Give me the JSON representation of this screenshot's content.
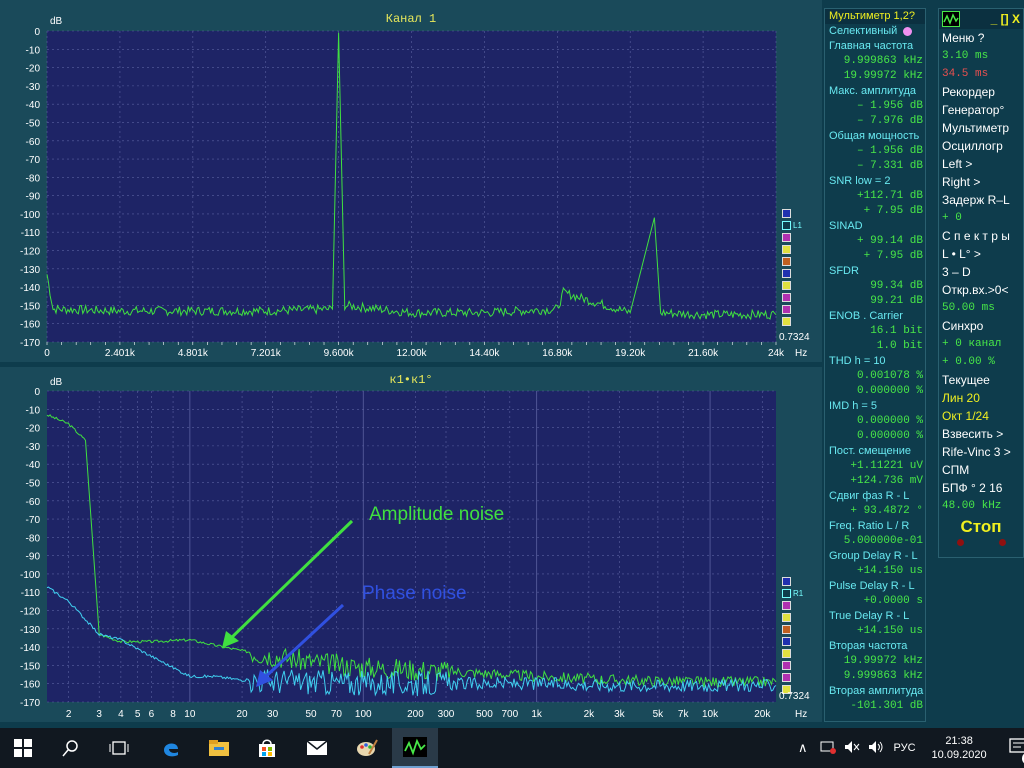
{
  "top_chart": {
    "title": "Канал 1",
    "y_unit": "dB",
    "x_unit": "Hz",
    "zoom_value": "0.7324",
    "legend_label": "L1",
    "y_ticks": [
      "0",
      "-10",
      "-20",
      "-30",
      "-40",
      "-50",
      "-60",
      "-70",
      "-80",
      "-90",
      "-100",
      "-110",
      "-120",
      "-130",
      "-140",
      "-150",
      "-160",
      "-170"
    ],
    "x_ticks": [
      "0",
      "2.401k",
      "4.801k",
      "7.201k",
      "9.600k",
      "12.00k",
      "14.40k",
      "16.80k",
      "19.20k",
      "21.60k",
      "24k"
    ],
    "legend_colors": [
      "#2030b0",
      "#2aa0b0",
      "#b030b0",
      "#e0e040",
      "#c06020",
      "#2030b0",
      "#e0e040",
      "#b030b0",
      "#b030b0",
      "#e0e040"
    ]
  },
  "bottom_chart": {
    "title": "к1•к1°",
    "y_unit": "dB",
    "x_unit": "Hz",
    "zoom_value": "0.7324",
    "legend_label": "R1",
    "y_ticks": [
      "0",
      "-10",
      "-20",
      "-30",
      "-40",
      "-50",
      "-60",
      "-70",
      "-80",
      "-90",
      "-100",
      "-110",
      "-120",
      "-130",
      "-140",
      "-150",
      "-160",
      "-170"
    ],
    "x_ticks": [
      "2",
      "3",
      "4",
      "5",
      "6",
      "8",
      "10",
      "20",
      "30",
      "50",
      "70",
      "100",
      "200",
      "300",
      "500",
      "700",
      "1k",
      "2k",
      "3k",
      "5k",
      "7k",
      "10k",
      "20k"
    ],
    "legend_colors": [
      "#2030b0",
      "#2aa0b0",
      "#b030b0",
      "#e0e040",
      "#c06020",
      "#2030b0",
      "#e0e040",
      "#b030b0",
      "#b030b0",
      "#e0e040"
    ],
    "annotation_amplitude": "Amplitude  noise",
    "annotation_phase": "Phase noise",
    "color_amplitude": "#40e040",
    "color_phase": "#3050e0"
  },
  "chart_data": [
    {
      "type": "line",
      "title": "Канал 1",
      "ylabel": "dB",
      "xlabel": "Hz",
      "xlim": [
        0,
        24000
      ],
      "ylim": [
        -170,
        0
      ],
      "grid": true,
      "series": [
        {
          "color": "#40e040",
          "x": [
            0,
            200,
            2400,
            4800,
            7200,
            9400,
            9600,
            9800,
            12000,
            14400,
            16800,
            17000,
            19200,
            19998,
            20200,
            21600,
            24000
          ],
          "y": [
            -133,
            -152,
            -153,
            -153,
            -153,
            -152,
            -1,
            -150,
            -154,
            -154,
            -152,
            -143,
            -154,
            -102,
            -154,
            -155,
            -155
          ]
        }
      ]
    },
    {
      "type": "line",
      "title": "к1•к1°",
      "ylabel": "dB",
      "xlabel": "Hz",
      "xscale": "log",
      "xlim": [
        1.5,
        24000
      ],
      "ylim": [
        -170,
        0
      ],
      "grid": true,
      "series": [
        {
          "name": "Amplitude  noise",
          "color": "#40e040",
          "x": [
            1.5,
            2,
            2.5,
            3,
            4,
            6,
            10,
            14,
            20,
            50,
            100,
            300,
            1000,
            3000,
            10000,
            20000,
            24000
          ],
          "y": [
            -13,
            -18,
            -27,
            -133,
            -137,
            -137,
            -136,
            -139,
            -142,
            -148,
            -151,
            -153,
            -156,
            -158,
            -159,
            -159,
            -159
          ]
        },
        {
          "name": "Phase noise",
          "color": "#40d0f0",
          "x": [
            1.5,
            2,
            3,
            4,
            6,
            10,
            14,
            20,
            50,
            100,
            300,
            1000,
            3000,
            10000,
            20000,
            24000
          ],
          "y": [
            -107,
            -115,
            -133,
            -136,
            -145,
            -156,
            -156,
            -158,
            -159,
            -160,
            -160,
            -160,
            -161,
            -161,
            -161,
            -161
          ]
        }
      ]
    }
  ],
  "multimeter": {
    "rows": [
      {
        "t": "Мультиметр 1,2?",
        "c": "head"
      },
      {
        "t": "Селективный",
        "c": "lbl"
      },
      {
        "t": "Главная частота",
        "c": "lbl"
      },
      {
        "t": "9.999863 kHz",
        "c": "val"
      },
      {
        "t": "19.99972 kHz",
        "c": "val"
      },
      {
        "t": "Макс. амплитуда",
        "c": "lbl"
      },
      {
        "t": "–  1.956 dB",
        "c": "val"
      },
      {
        "t": "–  7.976 dB",
        "c": "val"
      },
      {
        "t": "Общая мощность",
        "c": "lbl"
      },
      {
        "t": "–  1.956 dB",
        "c": "val"
      },
      {
        "t": "–  7.331 dB",
        "c": "val"
      },
      {
        "t": "SNR    low =  2",
        "c": "lbl"
      },
      {
        "t": "+112.71 dB",
        "c": "val"
      },
      {
        "t": "+  7.95 dB",
        "c": "val"
      },
      {
        "t": "SINAD",
        "c": "lbl"
      },
      {
        "t": "+ 99.14 dB",
        "c": "val"
      },
      {
        "t": "+  7.95 dB",
        "c": "val"
      },
      {
        "t": "SFDR",
        "c": "lbl"
      },
      {
        "t": "99.34 dB",
        "c": "val"
      },
      {
        "t": "99.21 dB",
        "c": "val"
      },
      {
        "t": "ENOB . Carrier",
        "c": "lbl"
      },
      {
        "t": "16.1 bit",
        "c": "val"
      },
      {
        "t": "1.0 bit",
        "c": "val"
      },
      {
        "t": "THD     h = 10",
        "c": "lbl"
      },
      {
        "t": "0.001078 %",
        "c": "val"
      },
      {
        "t": "0.000000 %",
        "c": "val"
      },
      {
        "t": "IMD     h =  5",
        "c": "lbl"
      },
      {
        "t": "0.000000 %",
        "c": "val"
      },
      {
        "t": "0.000000 %",
        "c": "val"
      },
      {
        "t": "Пост. смещение",
        "c": "lbl"
      },
      {
        "t": "+1.11221 uV",
        "c": "val"
      },
      {
        "t": "+124.736 mV",
        "c": "val"
      },
      {
        "t": "Сдвиг фаз R - L",
        "c": "lbl"
      },
      {
        "t": "+ 93.4872 °",
        "c": "val"
      },
      {
        "t": "Freq. Ratio  L / R",
        "c": "lbl"
      },
      {
        "t": "5.000000e-01",
        "c": "val"
      },
      {
        "t": "Group Delay R - L",
        "c": "lbl"
      },
      {
        "t": "+14.150 us",
        "c": "val"
      },
      {
        "t": "Pulse Delay R - L",
        "c": "lbl"
      },
      {
        "t": "+0.0000  s",
        "c": "val"
      },
      {
        "t": "True Delay R - L",
        "c": "lbl"
      },
      {
        "t": "+14.150 us",
        "c": "val"
      },
      {
        "t": "Вторая частота",
        "c": "lbl"
      },
      {
        "t": "19.99972 kHz",
        "c": "val"
      },
      {
        "t": "9.999863 kHz",
        "c": "val"
      },
      {
        "t": "Вторая амплитуда",
        "c": "lbl"
      },
      {
        "t": "-101.301 dB",
        "c": "val"
      }
    ]
  },
  "menu": {
    "title_controls": "_ [] X",
    "items": [
      {
        "t": "Меню          ?",
        "c": ""
      },
      {
        "t": "    3.10 ms",
        "c": "grn"
      },
      {
        "t": "   34.5 ms",
        "c": "red"
      },
      {
        "t": "  Рекордер",
        "c": ""
      },
      {
        "t": "   Генератор°",
        "c": ""
      },
      {
        "t": " Мультиметр",
        "c": ""
      },
      {
        "t": "  Осциллогр",
        "c": ""
      },
      {
        "t": "      Left     >",
        "c": ""
      },
      {
        "t": "     Right    >",
        "c": ""
      },
      {
        "t": " Задерж  R–L",
        "c": ""
      },
      {
        "t": " +       0",
        "c": "grn"
      },
      {
        "t": "  С п е к т р ы",
        "c": ""
      },
      {
        "t": "     L • L°    >",
        "c": ""
      },
      {
        "t": "      3 – D",
        "c": ""
      },
      {
        "t": " Откр.вх.>0<",
        "c": ""
      },
      {
        "t": "  50.00 ms",
        "c": "grn"
      },
      {
        "t": "     Синхро",
        "c": ""
      },
      {
        "t": " + 0 канал",
        "c": "grn"
      },
      {
        "t": " + 0.00 %",
        "c": "grn"
      },
      {
        "t": "    Текущее",
        "c": ""
      },
      {
        "t": " Лин       20",
        "c": "hl"
      },
      {
        "t": " Окт  1/24",
        "c": "hl"
      },
      {
        "t": "   Взвесить  >",
        "c": ""
      },
      {
        "t": " Rife-Vinc 3 >",
        "c": ""
      },
      {
        "t": "  СПМ",
        "c": ""
      },
      {
        "t": " БПФ ° 2 16",
        "c": ""
      },
      {
        "t": " 48.00 kHz",
        "c": "grn"
      }
    ],
    "stop_label": "Стоп"
  },
  "taskbar": {
    "language": "РУС",
    "time": "21:38",
    "date": "10.09.2020",
    "notification_count": "2",
    "icons": [
      "windows-start-icon",
      "search-icon",
      "task-view-icon",
      "edge-browser-icon",
      "file-explorer-icon",
      "store-icon",
      "mail-icon",
      "paint-icon",
      "spectrum-analyzer-app-icon"
    ]
  }
}
